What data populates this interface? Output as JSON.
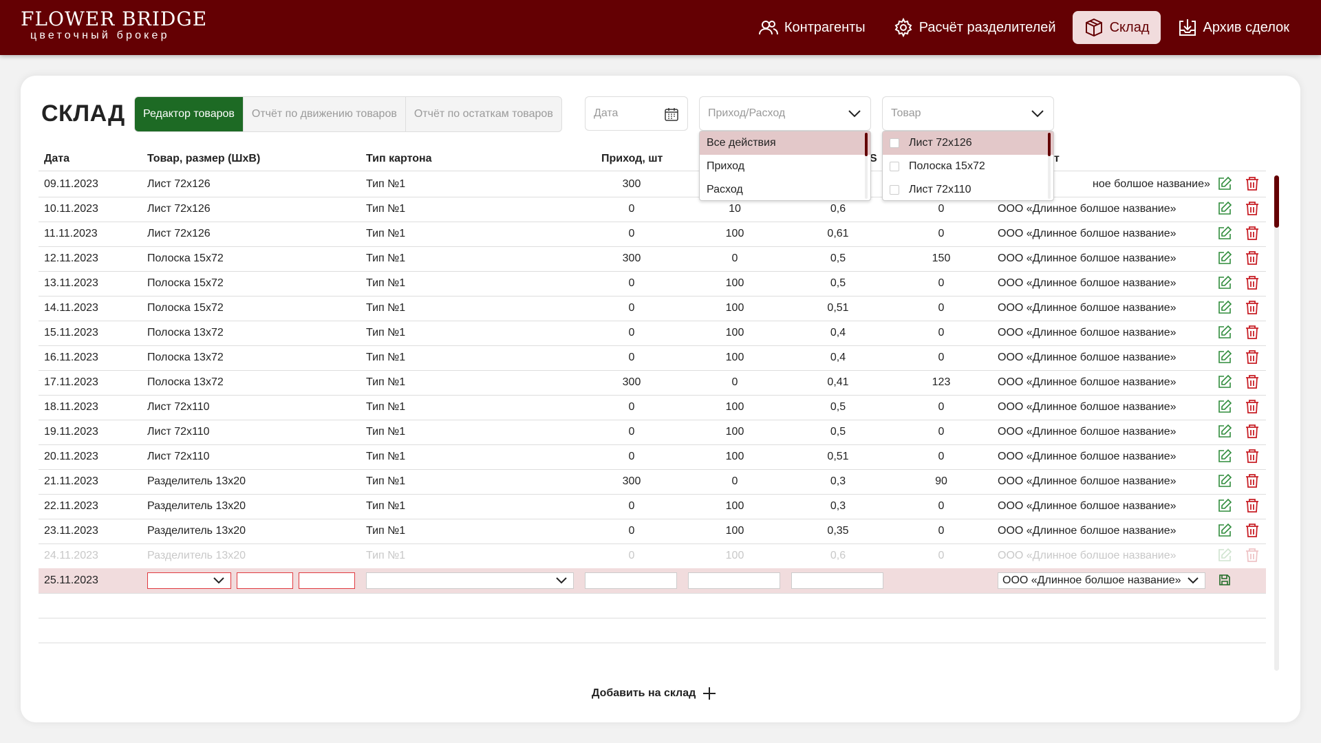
{
  "brand": {
    "name": "FLOWER BRIDGE",
    "tagline": "цветочный брокер"
  },
  "nav": [
    {
      "label": "Контрагенты",
      "icon": "users-icon",
      "active": false
    },
    {
      "label": "Расчёт разделителей",
      "icon": "gear-icon",
      "active": false
    },
    {
      "label": "Склад",
      "icon": "box-icon",
      "active": true
    },
    {
      "label": "Архив сделок",
      "icon": "download-icon",
      "active": false
    }
  ],
  "page": {
    "title": "СКЛАД"
  },
  "tabs": [
    {
      "label": "Редактор товаров",
      "active": true
    },
    {
      "label": "Отчёт по движению товаров",
      "active": false
    },
    {
      "label": "Отчёт по остаткам товаров",
      "active": false
    }
  ],
  "filters": {
    "date_placeholder": "Дата",
    "action_placeholder": "Приход/Расход",
    "product_placeholder": "Товар"
  },
  "action_dropdown": {
    "options": [
      "Все действия",
      "Приход",
      "Расход"
    ],
    "selected": "Все действия"
  },
  "product_dropdown": {
    "options": [
      "Лист 72x126",
      "Полоска 15x72",
      "Лист 72x110"
    ],
    "highlighted": "Лист 72x126"
  },
  "table": {
    "headers": {
      "date": "Дата",
      "product": "Товар, размер (ШхВ)",
      "carton": "Тип картона",
      "income": "Приход, шт",
      "col5_tail": "",
      "col7_fragment": "S",
      "partner_fragment": "т"
    },
    "rows": [
      [
        "09.11.2023",
        "Лист 72x126",
        "Тип №1",
        "300",
        "",
        "",
        "",
        "ООО «Длинное болшое название»"
      ],
      [
        "10.11.2023",
        "Лист 72x126",
        "Тип №1",
        "0",
        "10",
        "0,6",
        "0",
        "ООО «Длинное болшое название»"
      ],
      [
        "11.11.2023",
        "Лист 72x126",
        "Тип №1",
        "0",
        "100",
        "0,61",
        "0",
        "ООО «Длинное болшое название»"
      ],
      [
        "12.11.2023",
        "Полоска 15x72",
        "Тип №1",
        "300",
        "0",
        "0,5",
        "150",
        "ООО «Длинное болшое название»"
      ],
      [
        "13.11.2023",
        "Полоска 15x72",
        "Тип №1",
        "0",
        "100",
        "0,5",
        "0",
        "ООО «Длинное болшое название»"
      ],
      [
        "14.11.2023",
        "Полоска 15x72",
        "Тип №1",
        "0",
        "100",
        "0,51",
        "0",
        "ООО «Длинное болшое название»"
      ],
      [
        "15.11.2023",
        "Полоска 13x72",
        "Тип №1",
        "0",
        "100",
        "0,4",
        "0",
        "ООО «Длинное болшое название»"
      ],
      [
        "16.11.2023",
        "Полоска 13x72",
        "Тип №1",
        "0",
        "100",
        "0,4",
        "0",
        "ООО «Длинное болшое название»"
      ],
      [
        "17.11.2023",
        "Полоска 13x72",
        "Тип №1",
        "300",
        "0",
        "0,41",
        "123",
        "ООО «Длинное болшое название»"
      ],
      [
        "18.11.2023",
        "Лист 72x110",
        "Тип №1",
        "0",
        "100",
        "0,5",
        "0",
        "ООО «Длинное болшое название»"
      ],
      [
        "19.11.2023",
        "Лист 72x110",
        "Тип №1",
        "0",
        "100",
        "0,5",
        "0",
        "ООО «Длинное болшое название»"
      ],
      [
        "20.11.2023",
        "Лист 72x110",
        "Тип №1",
        "0",
        "100",
        "0,51",
        "0",
        "ООО «Длинное болшое название»"
      ],
      [
        "21.11.2023",
        "Разделитель 13x20",
        "Тип №1",
        "300",
        "0",
        "0,3",
        "90",
        "ООО «Длинное болшое название»"
      ],
      [
        "22.11.2023",
        "Разделитель 13x20",
        "Тип №1",
        "0",
        "100",
        "0,3",
        "0",
        "ООО «Длинное болшое название»"
      ],
      [
        "23.11.2023",
        "Разделитель 13x20",
        "Тип №1",
        "0",
        "100",
        "0,35",
        "0",
        "ООО «Длинное болшое название»"
      ],
      [
        "24.11.2023",
        "Разделитель 13x20",
        "Тип №1",
        "0",
        "100",
        "0,6",
        "0",
        "ООО «Длинное болшое название»"
      ]
    ],
    "partial_partner_first_row": "ное болшое название»"
  },
  "edit_row": {
    "date": "25.11.2023",
    "partner": "ООО «Длинное болшое название»"
  },
  "add_button": {
    "label": "Добавить на склад"
  },
  "colors": {
    "brand": "#640003",
    "accent_green": "#1d6a24",
    "edit_red": "#e0383e",
    "highlight": "#f1dcdd"
  }
}
